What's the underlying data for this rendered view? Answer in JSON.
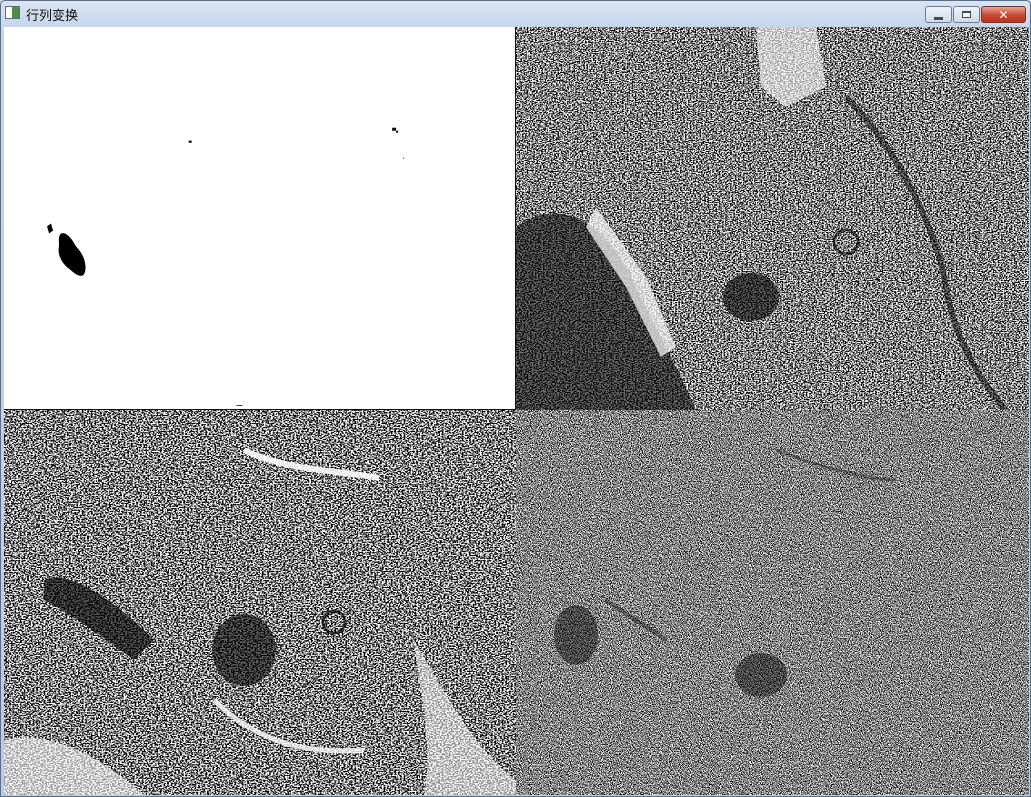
{
  "window": {
    "title": "行列变换",
    "icon": "app-window-icon",
    "controls": {
      "minimize": "minimize-icon",
      "maximize": "maximize-icon",
      "close": "close-icon"
    }
  },
  "panes": [
    {
      "id": "top-left",
      "content": "binary-threshold-image"
    },
    {
      "id": "top-right",
      "content": "row-transformed-image"
    },
    {
      "id": "bottom-left",
      "content": "column-transformed-image"
    },
    {
      "id": "bottom-right",
      "content": "row-column-transformed-image"
    }
  ],
  "colors": {
    "titlebar": "#c6d6ea",
    "close": "#c74a33",
    "ink": "#000000",
    "paper": "#ffffff"
  }
}
